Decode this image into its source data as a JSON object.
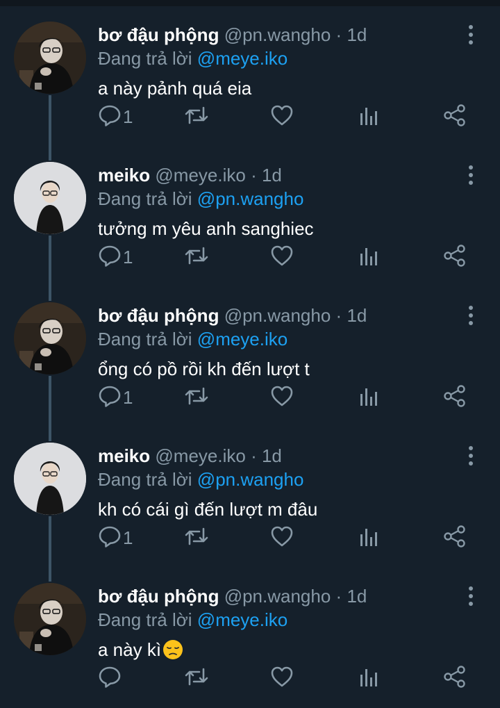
{
  "reply_prefix": "Đang trả lời",
  "tweets": [
    {
      "name": "bơ đậu phộng",
      "handle": "@pn.wangho",
      "sep": "·",
      "time": "1d",
      "reply_to": "@meye.iko",
      "text": "a này pảnh quá eia",
      "reply_count": "1",
      "avatar": "dark"
    },
    {
      "name": "meiko",
      "handle": "@meye.iko",
      "sep": "·",
      "time": "1d",
      "reply_to": "@pn.wangho",
      "text": "tưởng m yêu anh sanghiec",
      "reply_count": "1",
      "avatar": "light"
    },
    {
      "name": "bơ đậu phộng",
      "handle": "@pn.wangho",
      "sep": "·",
      "time": "1d",
      "reply_to": "@meye.iko",
      "text": "ổng có pồ rồi kh đến lượt t",
      "reply_count": "1",
      "avatar": "dark"
    },
    {
      "name": "meiko",
      "handle": "@meye.iko",
      "sep": "·",
      "time": "1d",
      "reply_to": "@pn.wangho",
      "text": "kh có cái gì đến lượt m đâu",
      "reply_count": "1",
      "avatar": "light"
    },
    {
      "name": "bơ đậu phộng",
      "handle": "@pn.wangho",
      "sep": "·",
      "time": "1d",
      "reply_to": "@meye.iko",
      "text": "a này kì",
      "text_emoji": "pensive-face",
      "reply_count": "",
      "avatar": "dark"
    }
  ],
  "colors": {
    "background": "#15202b",
    "muted": "#8899a6",
    "accent": "#1da1f2",
    "thread": "#3d5466"
  },
  "icons": [
    "more-vertical-icon",
    "reply-icon",
    "retweet-icon",
    "like-icon",
    "analytics-icon",
    "share-icon"
  ]
}
